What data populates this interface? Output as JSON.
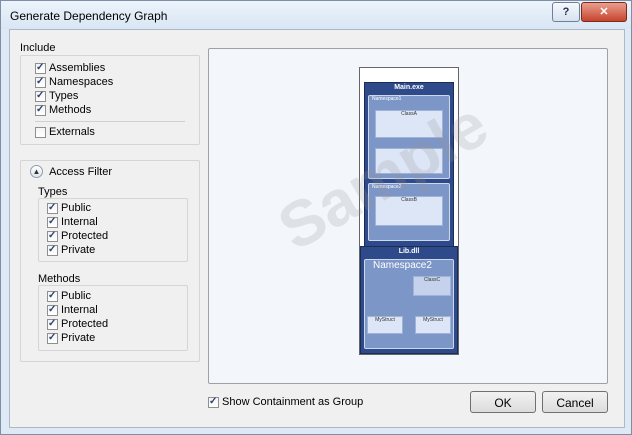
{
  "window": {
    "title": "Generate Dependency Graph",
    "help_label": "?",
    "close_label": "✕"
  },
  "include": {
    "label": "Include",
    "items": [
      {
        "label": "Assemblies",
        "checked": true
      },
      {
        "label": "Namespaces",
        "checked": true
      },
      {
        "label": "Types",
        "checked": true
      },
      {
        "label": "Methods",
        "checked": true
      }
    ],
    "externals": {
      "label": "Externals",
      "checked": false
    }
  },
  "access_filter": {
    "label": "Access Filter",
    "expander_glyph": "▲",
    "types": {
      "label": "Types",
      "items": [
        {
          "label": "Public",
          "checked": true
        },
        {
          "label": "Internal",
          "checked": true
        },
        {
          "label": "Protected",
          "checked": true
        },
        {
          "label": "Private",
          "checked": true
        }
      ]
    },
    "methods": {
      "label": "Methods",
      "items": [
        {
          "label": "Public",
          "checked": true
        },
        {
          "label": "Internal",
          "checked": true
        },
        {
          "label": "Protected",
          "checked": true
        },
        {
          "label": "Private",
          "checked": true
        }
      ]
    }
  },
  "preview": {
    "watermark": "Sample",
    "main": {
      "title": "Main.exe",
      "ns1": "Namespace1",
      "ns2": "Namespace2",
      "classA": "ClassA",
      "classB": "ClassB"
    },
    "lib": {
      "title": "Lib.dll",
      "ns": "Namespace2",
      "classC": "ClassC",
      "m1": "MyStruct",
      "m2": "MyStruct"
    }
  },
  "footer": {
    "show_containment": {
      "label": "Show Containment as Group",
      "checked": true
    },
    "ok_label": "OK",
    "cancel_label": "Cancel"
  },
  "colors": {
    "accent": "#2f4a8a",
    "close": "#c7442e"
  }
}
